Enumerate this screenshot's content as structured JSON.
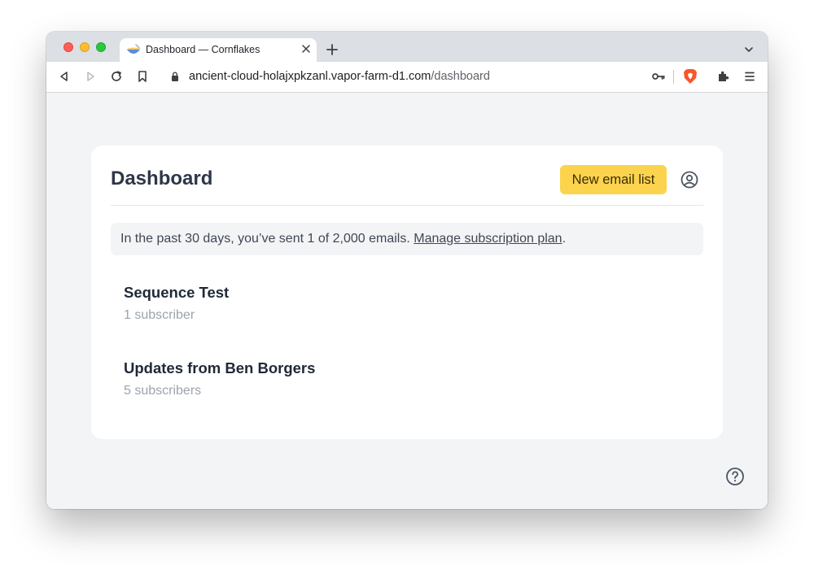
{
  "browser": {
    "tab_title": "Dashboard — Cornflakes",
    "url_host": "ancient-cloud-holajxpkzanl.vapor-farm-d1.com",
    "url_path": "/dashboard",
    "icons": [
      "back-icon",
      "forward-icon",
      "reload-icon",
      "bookmark-icon",
      "lock-icon",
      "key-icon",
      "brave-shield-icon",
      "extensions-icon",
      "menu-icon",
      "new-tab-icon",
      "tab-close-icon",
      "tab-list-icon"
    ]
  },
  "page": {
    "title": "Dashboard",
    "new_list_button": "New email list",
    "usage_text": "In the past 30 days, you’ve sent 1 of 2,000 emails.",
    "usage_link": "Manage subscription plan",
    "usage_suffix": ".",
    "lists": [
      {
        "name": "Sequence Test",
        "subscribers": "1 subscriber"
      },
      {
        "name": "Updates from Ben Borgers",
        "subscribers": "5 subscribers"
      }
    ]
  },
  "colors": {
    "accent_button": "#fcd34d",
    "page_bg": "#f3f4f6",
    "card_bg": "#ffffff"
  }
}
